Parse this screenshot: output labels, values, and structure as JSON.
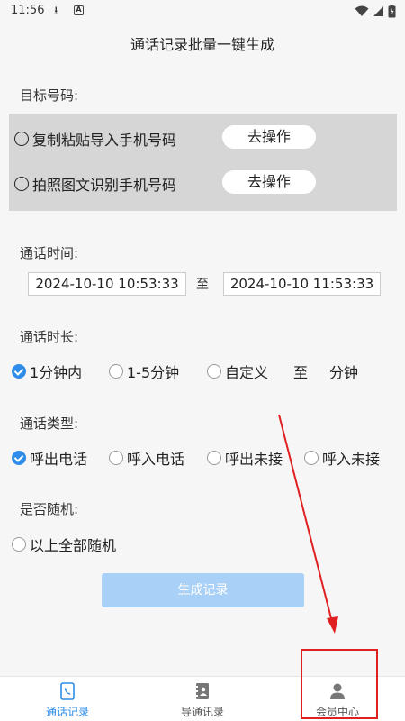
{
  "status_bar": {
    "time": "11:56"
  },
  "header": {
    "title": "通话记录批量一键生成"
  },
  "target": {
    "label": "目标号码:",
    "options": [
      {
        "label": "复制粘贴导入手机号码",
        "action": "去操作"
      },
      {
        "label": "拍照图文识别手机号码",
        "action": "去操作"
      }
    ]
  },
  "call_time": {
    "label": "通话时间:",
    "start": "2024-10-10 10:53:33",
    "separator": "至",
    "end": "2024-10-10 11:53:33"
  },
  "duration": {
    "label": "通话时长:",
    "options": [
      "1分钟内",
      "1-5分钟",
      "自定义"
    ],
    "selected": "1分钟内",
    "custom_to": "至",
    "custom_unit": "分钟"
  },
  "call_type": {
    "label": "通话类型:",
    "options": [
      "呼出电话",
      "呼入电话",
      "呼出未接",
      "呼入未接"
    ],
    "selected": "呼出电话"
  },
  "random": {
    "label": "是否随机:",
    "option": "以上全部随机"
  },
  "generate_button": "生成记录",
  "bottom_nav": {
    "items": [
      {
        "label": "通话记录",
        "icon": "phone-record-icon",
        "active": true
      },
      {
        "label": "导通讯录",
        "icon": "contacts-book-icon",
        "active": false
      },
      {
        "label": "会员中心",
        "icon": "user-icon",
        "active": false
      }
    ]
  },
  "colors": {
    "accent": "#2e8de8",
    "button_disabled": "#a9d0f6",
    "annotation": "#e02020"
  }
}
